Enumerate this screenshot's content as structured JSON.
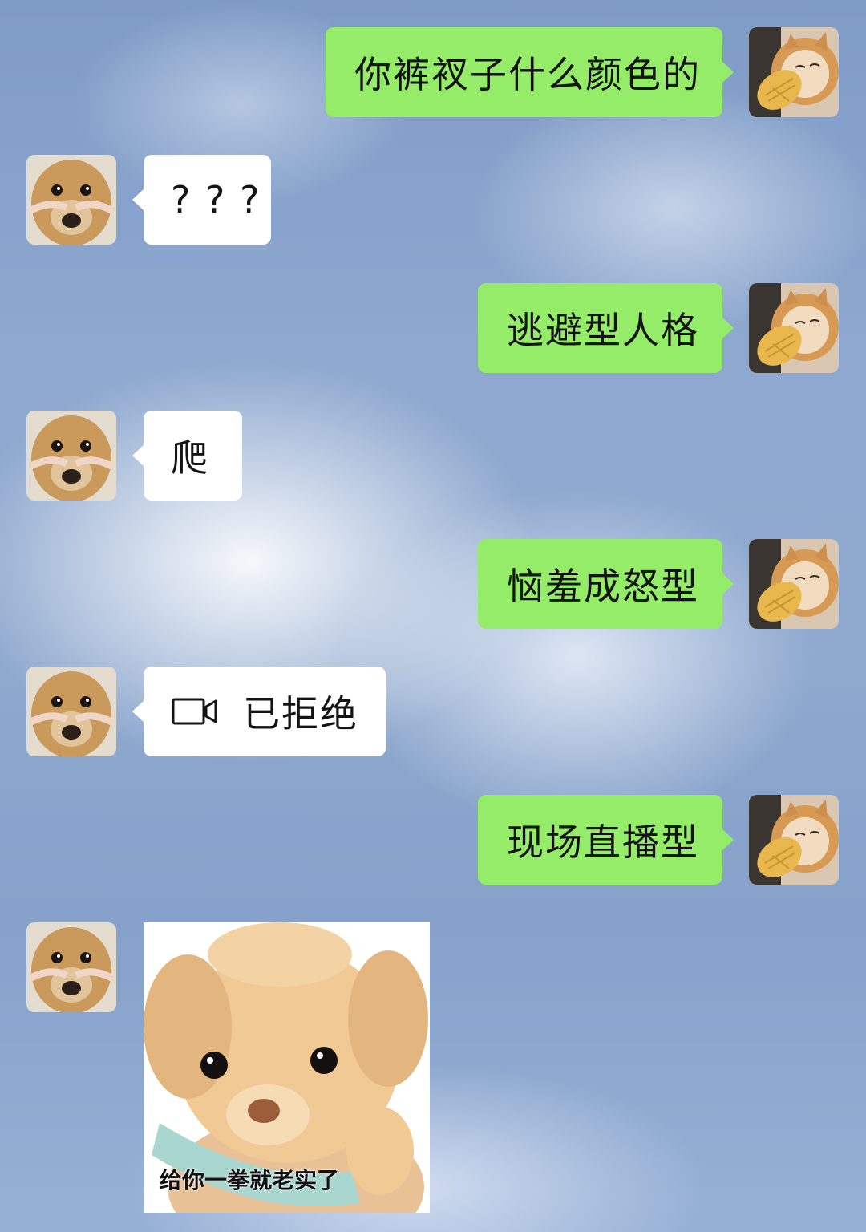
{
  "messages": [
    {
      "side": "right",
      "text": "你裤衩子什么颜色的"
    },
    {
      "side": "left",
      "text": "? ? ?"
    },
    {
      "side": "right",
      "text": "逃避型人格"
    },
    {
      "side": "left",
      "text": "爬"
    },
    {
      "side": "right",
      "text": "恼羞成怒型"
    },
    {
      "side": "left",
      "text": "已拒绝",
      "icon": "video-call-icon"
    },
    {
      "side": "right",
      "text": "现场直播型"
    },
    {
      "side": "left",
      "sticker": "teddy-bear-sticker",
      "caption": "给你一拳就老实了"
    }
  ],
  "colors": {
    "sent_bubble": "#95ec69",
    "received_bubble": "#ffffff"
  }
}
